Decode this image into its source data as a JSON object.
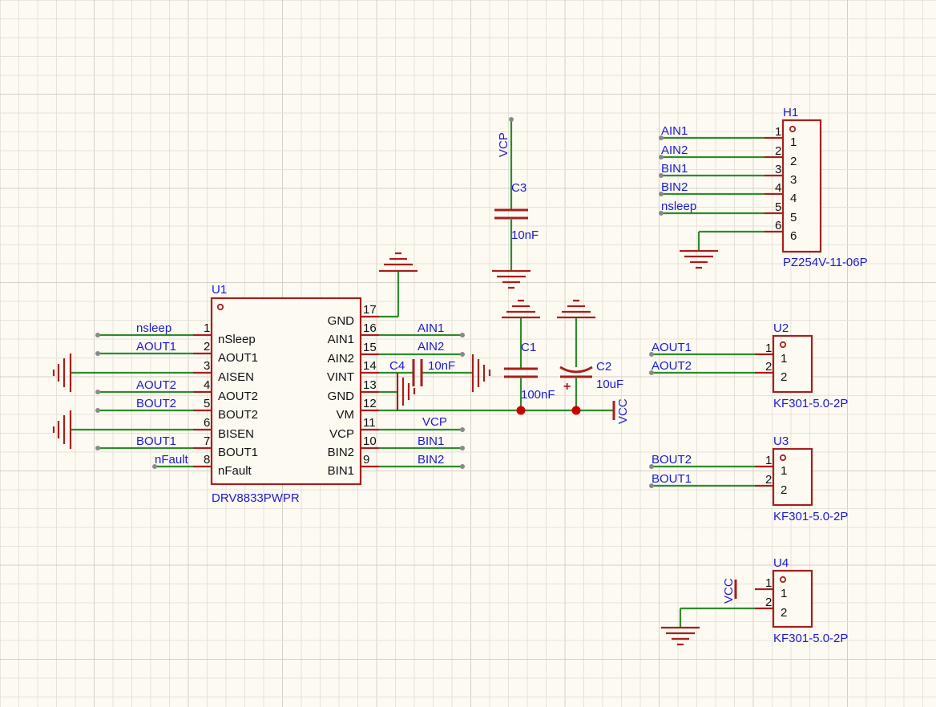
{
  "colors": {
    "background": "#fdfaf2",
    "wire": "#2e8b2e",
    "symbol": "#a51f1f",
    "label": "#1a1ad0",
    "pin_text": "#111111",
    "junction": "#cc0000"
  },
  "u1": {
    "ref": "U1",
    "value": "DRV8833PWPR",
    "left_pins": [
      {
        "num": "1",
        "name": "nSleep",
        "net": "nsleep"
      },
      {
        "num": "2",
        "name": "AOUT1",
        "net": "AOUT1"
      },
      {
        "num": "3",
        "name": "AISEN",
        "net": ""
      },
      {
        "num": "4",
        "name": "AOUT2",
        "net": "AOUT2"
      },
      {
        "num": "5",
        "name": "BOUT2",
        "net": "BOUT2"
      },
      {
        "num": "6",
        "name": "BISEN",
        "net": ""
      },
      {
        "num": "7",
        "name": "BOUT1",
        "net": "BOUT1"
      },
      {
        "num": "8",
        "name": "nFault",
        "net": "nFault"
      }
    ],
    "right_pins": [
      {
        "num": "17",
        "name": "GND",
        "net": ""
      },
      {
        "num": "16",
        "name": "AIN1",
        "net": "AIN1"
      },
      {
        "num": "15",
        "name": "AIN2",
        "net": "AIN2"
      },
      {
        "num": "14",
        "name": "VINT",
        "net": ""
      },
      {
        "num": "13",
        "name": "GND",
        "net": ""
      },
      {
        "num": "12",
        "name": "VM",
        "net": ""
      },
      {
        "num": "11",
        "name": "VCP",
        "net": "VCP"
      },
      {
        "num": "10",
        "name": "BIN2",
        "net": "BIN1"
      },
      {
        "num": "9",
        "name": "BIN1",
        "net": "BIN2"
      }
    ]
  },
  "c1": {
    "ref": "C1",
    "value": "100nF"
  },
  "c2": {
    "ref": "C2",
    "value": "10uF"
  },
  "c3": {
    "ref": "C3",
    "value": "10nF",
    "net": "VCP"
  },
  "c4": {
    "ref": "C4",
    "value": "10nF"
  },
  "vm_net": "VCC",
  "h1": {
    "ref": "H1",
    "value": "PZ254V-11-06P",
    "pins": [
      {
        "num": "1",
        "label": "1",
        "net": "AIN1"
      },
      {
        "num": "2",
        "label": "2",
        "net": "AIN2"
      },
      {
        "num": "3",
        "label": "3",
        "net": "BIN1"
      },
      {
        "num": "4",
        "label": "4",
        "net": "BIN2"
      },
      {
        "num": "5",
        "label": "5",
        "net": "nsleep"
      },
      {
        "num": "6",
        "label": "6",
        "net": ""
      }
    ]
  },
  "u2": {
    "ref": "U2",
    "value": "KF301-5.0-2P",
    "pins": [
      {
        "num": "1",
        "label": "1",
        "net": "AOUT1"
      },
      {
        "num": "2",
        "label": "2",
        "net": "AOUT2"
      }
    ]
  },
  "u3": {
    "ref": "U3",
    "value": "KF301-5.0-2P",
    "pins": [
      {
        "num": "1",
        "label": "1",
        "net": "BOUT2"
      },
      {
        "num": "2",
        "label": "2",
        "net": "BOUT1"
      }
    ]
  },
  "u4": {
    "ref": "U4",
    "value": "KF301-5.0-2P",
    "pins": [
      {
        "num": "1",
        "label": "1",
        "net": "VCC"
      },
      {
        "num": "2",
        "label": "2",
        "net": ""
      }
    ]
  }
}
